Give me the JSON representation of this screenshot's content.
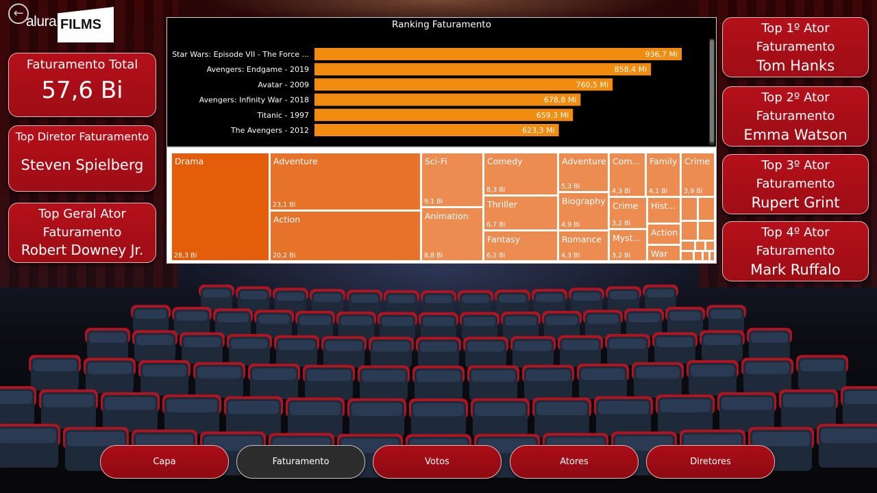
{
  "logo": {
    "alura": "alura",
    "films": "FILMS"
  },
  "kpi": {
    "total_label": "Faturamento Total",
    "total_value": "57,6 Bi",
    "director_label": "Top Diretor Faturamento",
    "director_value": "Steven Spielberg",
    "top_actor_label_1": "Top Geral Ator",
    "top_actor_label_2": "Faturamento",
    "top_actor_value": "Robert Downey Jr."
  },
  "actors": [
    {
      "label_1": "Top 1º Ator",
      "label_2": "Faturamento",
      "name": "Tom Hanks"
    },
    {
      "label_1": "Top 2º Ator",
      "label_2": "Faturamento",
      "name": "Emma Watson"
    },
    {
      "label_1": "Top 3º Ator",
      "label_2": "Faturamento",
      "name": "Rupert Grint"
    },
    {
      "label_1": "Top 4º Ator",
      "label_2": "Faturamento",
      "name": "Mark Ruffalo"
    }
  ],
  "chart_data": [
    {
      "type": "bar",
      "orientation": "horizontal",
      "title": "Ranking Faturamento",
      "categories": [
        "Star Wars: Episode VII - The Force ...",
        "Avengers: Endgame - 2019",
        "Avatar - 2009",
        "Avengers: Infinity War - 2018",
        "Titanic - 1997",
        "The Avengers - 2012"
      ],
      "values": [
        936.7,
        858.4,
        760.5,
        678.8,
        659.3,
        623.3
      ],
      "data_labels": [
        "936,7 Mi",
        "858,4 Mi",
        "760,5 Mi",
        "678,8 Mi",
        "659,3 Mi",
        "623,3 Mi"
      ],
      "unit": "Mi",
      "color": "#f28c0f"
    },
    {
      "type": "treemap",
      "items": [
        {
          "label": "Drama",
          "value": 28.3,
          "value_label": "28,3 Bi"
        },
        {
          "label": "Adventure",
          "value": 23.1,
          "value_label": "23,1 Bi"
        },
        {
          "label": "Action",
          "value": 20.2,
          "value_label": "20,2 Bi"
        },
        {
          "label": "Sci-Fi",
          "value": 9.1,
          "value_label": "9,1 Bi"
        },
        {
          "label": "Animation",
          "value": 8.8,
          "value_label": "8,8 Bi"
        },
        {
          "label": "Comedy",
          "value": 8.3,
          "value_label": "8,3 Bi"
        },
        {
          "label": "Thriller",
          "value": 6.7,
          "value_label": "6,7 Bi"
        },
        {
          "label": "Fantasy",
          "value": 6.2,
          "value_label": "6,2 Bi"
        },
        {
          "label": "Adventure",
          "value": 5.3,
          "value_label": "5,3 Bi"
        },
        {
          "label": "Biography",
          "value": 4.9,
          "value_label": "4,9 Bi"
        },
        {
          "label": "Romance",
          "value": 4.3,
          "value_label": "4,3 Bi"
        },
        {
          "label": "Com...",
          "value": 4.3,
          "value_label": "4,3 Bi"
        },
        {
          "label": "Family",
          "value": 4.1,
          "value_label": "4,1 Bi"
        },
        {
          "label": "Crime",
          "value": 3.9,
          "value_label": "3,9 Bi"
        },
        {
          "label": "Crime",
          "value": 3.2,
          "value_label": "3,2 Bi"
        },
        {
          "label": "Myst...",
          "value": 3.2,
          "value_label": "3,2 Bi"
        },
        {
          "label": "Hist...",
          "value": null,
          "value_label": ""
        },
        {
          "label": "Action",
          "value": null,
          "value_label": ""
        },
        {
          "label": "War",
          "value": null,
          "value_label": ""
        }
      ],
      "colors": {
        "large": "#e35d0b",
        "medium": "#e7722a",
        "light": "#ec8c50"
      }
    }
  ],
  "nav": {
    "capa": "Capa",
    "faturamento": "Faturamento",
    "votos": "Votos",
    "atores": "Atores",
    "diretores": "Diretores",
    "active": "Faturamento"
  }
}
